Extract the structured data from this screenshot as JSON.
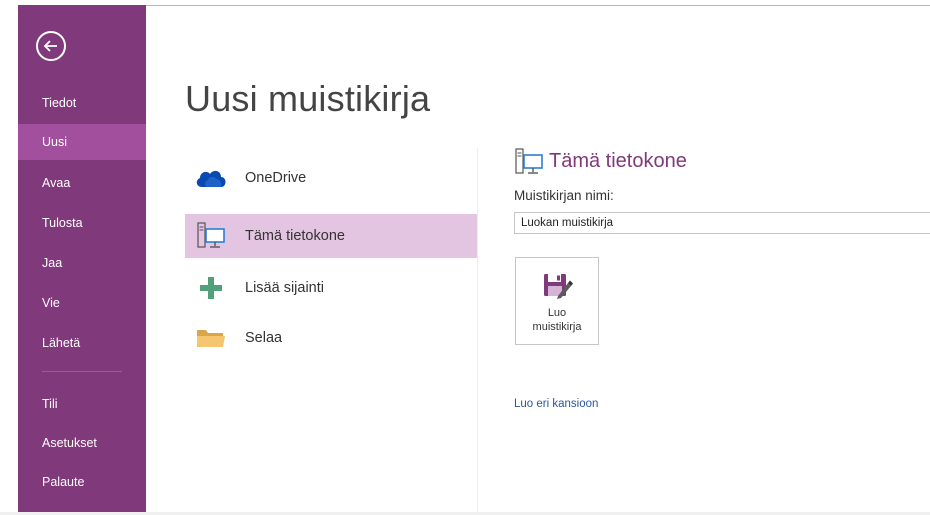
{
  "sidebar": {
    "back_label": "Back",
    "items": [
      {
        "label": "Tiedot"
      },
      {
        "label": "Uusi",
        "active": true
      },
      {
        "label": "Avaa"
      },
      {
        "label": "Tulosta"
      },
      {
        "label": "Jaa"
      },
      {
        "label": "Vie"
      },
      {
        "label": "Lähetä"
      },
      {
        "label": "Tili"
      },
      {
        "label": "Asetukset"
      },
      {
        "label": "Palaute"
      }
    ]
  },
  "main": {
    "title": "Uusi muistikirja",
    "locations": [
      {
        "label": "OneDrive",
        "icon": "cloud-icon"
      },
      {
        "label": "Tämä tietokone",
        "icon": "computer-icon",
        "selected": true
      },
      {
        "label": "Lisää sijainti",
        "icon": "plus-icon"
      },
      {
        "label": "Selaa",
        "icon": "folder-icon"
      }
    ]
  },
  "pane": {
    "title": "Tämä tietokone",
    "name_label": "Muistikirjan nimi:",
    "name_value": "Luokan muistikirja",
    "create_button_line1": "Luo",
    "create_button_line2": "muistikirja",
    "other_folder_link": "Luo eri kansioon"
  },
  "colors": {
    "sidebar_bg": "#80397b",
    "sidebar_active": "#a2509d",
    "selected_location": "#e3c4e1",
    "accent_text": "#80397b",
    "link": "#2b579a"
  }
}
